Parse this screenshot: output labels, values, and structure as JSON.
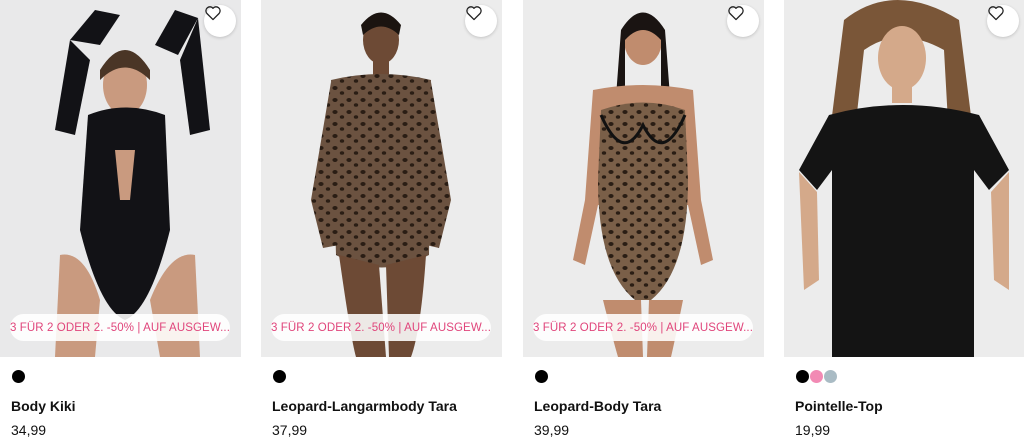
{
  "products": [
    {
      "name": "Body Kiki",
      "price": "34,99",
      "promo": "3 FÜR 2 ODER 2. -50% | AUF AUSGEW...",
      "swatches": [
        "#000000"
      ],
      "image_background": "#e9e9ea",
      "garment_color": "#121216",
      "favorite_icon": "heart-outline-icon"
    },
    {
      "name": "Leopard-Langarmbody Tara",
      "price": "37,99",
      "promo": "3 FÜR 2 ODER 2. -50% | AUF AUSGEW...",
      "swatches": [
        "#000000"
      ],
      "image_background": "#ececec",
      "garment_color": "#5a4230",
      "favorite_icon": "heart-outline-icon"
    },
    {
      "name": "Leopard-Body Tara",
      "price": "39,99",
      "promo": "3 FÜR 2 ODER 2. -50% | AUF AUSGEW...",
      "swatches": [
        "#000000"
      ],
      "image_background": "#ececec",
      "garment_color": "#6b5240",
      "favorite_icon": "heart-outline-icon"
    },
    {
      "name": "Pointelle-Top",
      "price": "19,99",
      "swatches": [
        "#000000",
        "#f28ab4",
        "#a9bbc4"
      ],
      "image_background": "#ececec",
      "garment_color": "#141414",
      "favorite_icon": "heart-outline-icon"
    }
  ],
  "colors": {
    "promo_text": "#e0457b",
    "text": "#111111"
  }
}
